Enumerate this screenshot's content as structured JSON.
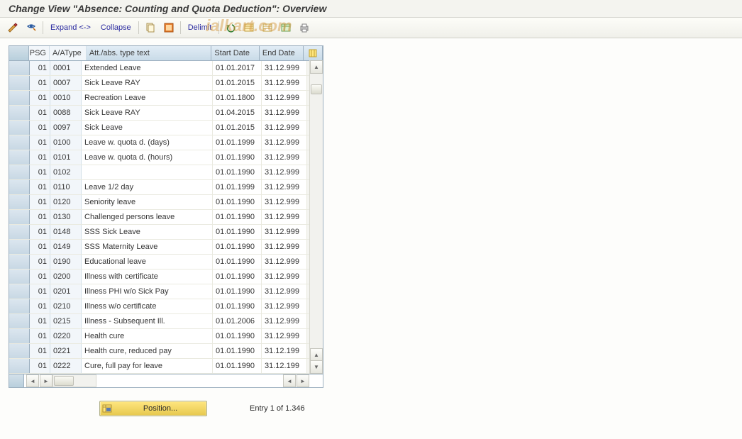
{
  "title": "Change View \"Absence: Counting and Quota Deduction\": Overview",
  "toolbar": {
    "expand": "Expand <->",
    "collapse": "Collapse",
    "delimit": "Delimit"
  },
  "watermark": "ialkart.com",
  "columns": {
    "psg": "PSG",
    "aatype": "A/AType",
    "text": "Att./abs. type text",
    "start": "Start Date",
    "end": "End Date"
  },
  "rows": [
    {
      "psg": "01",
      "type": "0001",
      "text": "Extended Leave",
      "start": "01.01.2017",
      "end": "31.12.999"
    },
    {
      "psg": "01",
      "type": "0007",
      "text": "Sick Leave RAY",
      "start": "01.01.2015",
      "end": "31.12.999"
    },
    {
      "psg": "01",
      "type": "0010",
      "text": "Recreation Leave",
      "start": "01.01.1800",
      "end": "31.12.999"
    },
    {
      "psg": "01",
      "type": "0088",
      "text": "Sick Leave RAY",
      "start": "01.04.2015",
      "end": "31.12.999"
    },
    {
      "psg": "01",
      "type": "0097",
      "text": "Sick Leave",
      "start": "01.01.2015",
      "end": "31.12.999"
    },
    {
      "psg": "01",
      "type": "0100",
      "text": "Leave w. quota d. (days)",
      "start": "01.01.1999",
      "end": "31.12.999"
    },
    {
      "psg": "01",
      "type": "0101",
      "text": "Leave w. quota d. (hours)",
      "start": "01.01.1990",
      "end": "31.12.999"
    },
    {
      "psg": "01",
      "type": "0102",
      "text": "",
      "start": "01.01.1990",
      "end": "31.12.999"
    },
    {
      "psg": "01",
      "type": "0110",
      "text": "Leave 1/2 day",
      "start": "01.01.1999",
      "end": "31.12.999"
    },
    {
      "psg": "01",
      "type": "0120",
      "text": "Seniority leave",
      "start": "01.01.1990",
      "end": "31.12.999"
    },
    {
      "psg": "01",
      "type": "0130",
      "text": "Challenged persons leave",
      "start": "01.01.1990",
      "end": "31.12.999"
    },
    {
      "psg": "01",
      "type": "0148",
      "text": "SSS Sick Leave",
      "start": "01.01.1990",
      "end": "31.12.999"
    },
    {
      "psg": "01",
      "type": "0149",
      "text": "SSS Maternity Leave",
      "start": "01.01.1990",
      "end": "31.12.999"
    },
    {
      "psg": "01",
      "type": "0190",
      "text": "Educational leave",
      "start": "01.01.1990",
      "end": "31.12.999"
    },
    {
      "psg": "01",
      "type": "0200",
      "text": "Illness with certificate",
      "start": "01.01.1990",
      "end": "31.12.999"
    },
    {
      "psg": "01",
      "type": "0201",
      "text": "Illness PHI w/o Sick Pay",
      "start": "01.01.1990",
      "end": "31.12.999"
    },
    {
      "psg": "01",
      "type": "0210",
      "text": "Illness w/o certificate",
      "start": "01.01.1990",
      "end": "31.12.999"
    },
    {
      "psg": "01",
      "type": "0215",
      "text": "Illness - Subsequent Ill.",
      "start": "01.01.2006",
      "end": "31.12.999"
    },
    {
      "psg": "01",
      "type": "0220",
      "text": "Health cure",
      "start": "01.01.1990",
      "end": "31.12.999"
    },
    {
      "psg": "01",
      "type": "0221",
      "text": "Health cure, reduced pay",
      "start": "01.01.1990",
      "end": "31.12.199"
    },
    {
      "psg": "01",
      "type": "0222",
      "text": "Cure, full pay for leave",
      "start": "01.01.1990",
      "end": "31.12.199"
    }
  ],
  "footer": {
    "position_label": "Position...",
    "entry": "Entry 1 of 1.346"
  }
}
